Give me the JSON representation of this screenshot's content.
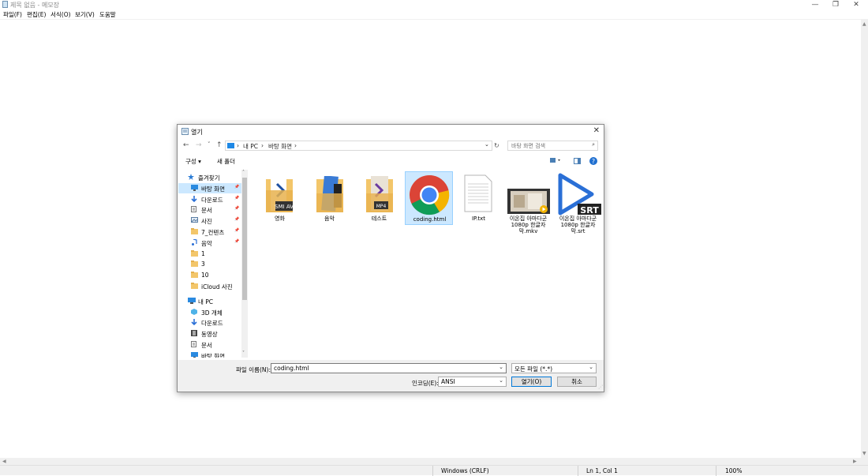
{
  "notepad": {
    "title": "제목 없음 - 메모장",
    "menu": [
      "파일(F)",
      "편집(E)",
      "서식(O)",
      "보기(V)",
      "도움말"
    ],
    "window_buttons": {
      "minimize": "—",
      "restore": "❐",
      "close": "✕"
    },
    "status": {
      "line_ending": "Windows (CRLF)",
      "position": "Ln 1, Col 1",
      "zoom": "100%"
    }
  },
  "dialog": {
    "title": "열기",
    "close": "✕",
    "nav": {
      "back": "←",
      "forward": "→",
      "recent": "˅",
      "up": "↑",
      "refresh": "↻"
    },
    "address": {
      "segments": [
        "내 PC",
        "바탕 화면"
      ],
      "sep": "›"
    },
    "search_placeholder": "바탕 화면 검색",
    "toolbar": {
      "organize": "구성 ▾",
      "new_folder": "새 폴더"
    },
    "sidebar": [
      {
        "label": "즐겨찾기",
        "icon": "star-icon",
        "pinned": false,
        "indent": 0
      },
      {
        "label": "바탕 화면",
        "icon": "desktop-icon",
        "pinned": true,
        "indent": 1,
        "selected": true
      },
      {
        "label": "다운로드",
        "icon": "download-icon",
        "pinned": true,
        "indent": 1
      },
      {
        "label": "문서",
        "icon": "document-icon",
        "pinned": true,
        "indent": 1
      },
      {
        "label": "사진",
        "icon": "picture-icon",
        "pinned": true,
        "indent": 1
      },
      {
        "label": "7_컨텐츠",
        "icon": "folder-icon",
        "pinned": true,
        "indent": 1
      },
      {
        "label": "음악",
        "icon": "music-icon",
        "pinned": true,
        "indent": 1
      },
      {
        "label": "1",
        "icon": "folder-icon",
        "pinned": false,
        "indent": 1
      },
      {
        "label": "3",
        "icon": "folder-icon",
        "pinned": false,
        "indent": 1
      },
      {
        "label": "10",
        "icon": "folder-icon",
        "pinned": false,
        "indent": 1
      },
      {
        "label": "iCloud 사진",
        "icon": "folder-icon",
        "pinned": false,
        "indent": 1
      },
      {
        "label": "내 PC",
        "icon": "pc-icon",
        "pinned": false,
        "indent": 0,
        "gap": true
      },
      {
        "label": "3D 개체",
        "icon": "cube-icon",
        "pinned": false,
        "indent": 1
      },
      {
        "label": "다운로드",
        "icon": "download-icon",
        "pinned": false,
        "indent": 1
      },
      {
        "label": "동영상",
        "icon": "video-icon",
        "pinned": false,
        "indent": 1
      },
      {
        "label": "문서",
        "icon": "document-icon",
        "pinned": false,
        "indent": 1
      },
      {
        "label": "바탕 화면",
        "icon": "desktop-icon",
        "pinned": false,
        "indent": 1
      }
    ],
    "files": [
      {
        "name": "영화",
        "kind": "folder",
        "badge": "SMI AV"
      },
      {
        "name": "음악",
        "kind": "folder",
        "badge": ""
      },
      {
        "name": "테스트",
        "kind": "folder",
        "badge": "MP4"
      },
      {
        "name": "coding.html",
        "kind": "chrome",
        "selected": true
      },
      {
        "name": "IP.txt",
        "kind": "text"
      },
      {
        "name": "이온집 아마다군 1080p 한글자막.mkv",
        "kind": "video"
      },
      {
        "name": "이온집 아마다군 1080p 한글자막.srt",
        "kind": "srt",
        "badge": "SRT"
      }
    ],
    "filename_label": "파일 이름(N):",
    "filename_value": "coding.html",
    "filetype_value": "모든 파일 (*.*)",
    "encoding_label": "인코딩(E):",
    "encoding_value": "ANSI",
    "open_button": "열기(O)",
    "cancel_button": "취소",
    "colors": {
      "accent": "#0078d7",
      "selection": "#cce8ff",
      "folder": "#f3c66a"
    }
  }
}
